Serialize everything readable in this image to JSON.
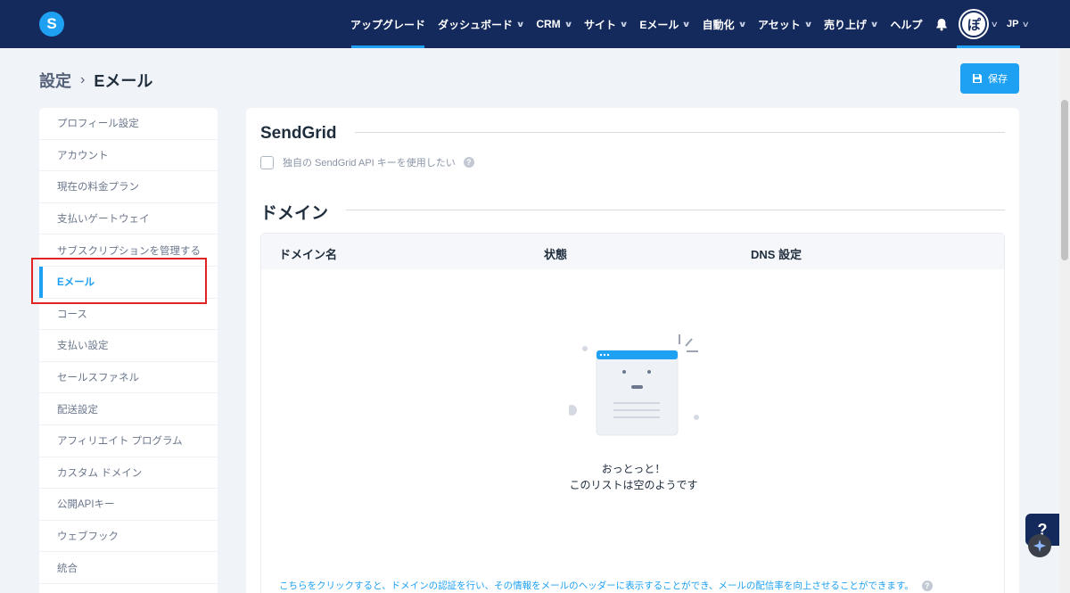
{
  "nav": {
    "logo_letter": "S",
    "items": [
      {
        "label": "アップグレード",
        "chevron": false,
        "active": true
      },
      {
        "label": "ダッシュボード",
        "chevron": true
      },
      {
        "label": "CRM",
        "chevron": true
      },
      {
        "label": "サイト",
        "chevron": true
      },
      {
        "label": "Eメール",
        "chevron": true
      },
      {
        "label": "自動化",
        "chevron": true
      },
      {
        "label": "アセット",
        "chevron": true
      },
      {
        "label": "売り上げ",
        "chevron": true
      },
      {
        "label": "ヘルプ",
        "chevron": false
      }
    ],
    "avatar_text": "ぽ",
    "lang": "JP"
  },
  "breadcrumb": {
    "parent": "設定",
    "separator": "›",
    "current": "Eメール"
  },
  "save_button": {
    "label": "保存"
  },
  "sidebar": {
    "items": [
      {
        "label": "プロフィール設定"
      },
      {
        "label": "アカウント"
      },
      {
        "label": "現在の料金プラン"
      },
      {
        "label": "支払いゲートウェイ"
      },
      {
        "label": "サブスクリプションを管理する"
      },
      {
        "label": "Eメール",
        "active": true
      },
      {
        "label": "コース"
      },
      {
        "label": "支払い設定"
      },
      {
        "label": "セールスファネル"
      },
      {
        "label": "配送設定"
      },
      {
        "label": "アフィリエイト プログラム"
      },
      {
        "label": "カスタム ドメイン"
      },
      {
        "label": "公開APIキー"
      },
      {
        "label": "ウェブフック"
      },
      {
        "label": "統合"
      }
    ]
  },
  "sendgrid": {
    "title": "SendGrid",
    "checkbox_label": "独自の SendGrid API キーを使用したい",
    "checked": false
  },
  "domain": {
    "title": "ドメイン",
    "columns": [
      "ドメイン名",
      "状態",
      "DNS 設定"
    ],
    "empty_line1": "おっとっと！",
    "empty_line2": "このリストは空のようです",
    "footnote": "こちらをクリックすると、ドメインの認証を行い、その情報をメールのヘッダーに表示することができ、メールの配信率を向上させることができます。"
  },
  "help_fab": {
    "label": "?"
  },
  "colors": {
    "nav_bg": "#152a5c",
    "accent": "#1ea1f2",
    "highlight": "#e02424"
  }
}
